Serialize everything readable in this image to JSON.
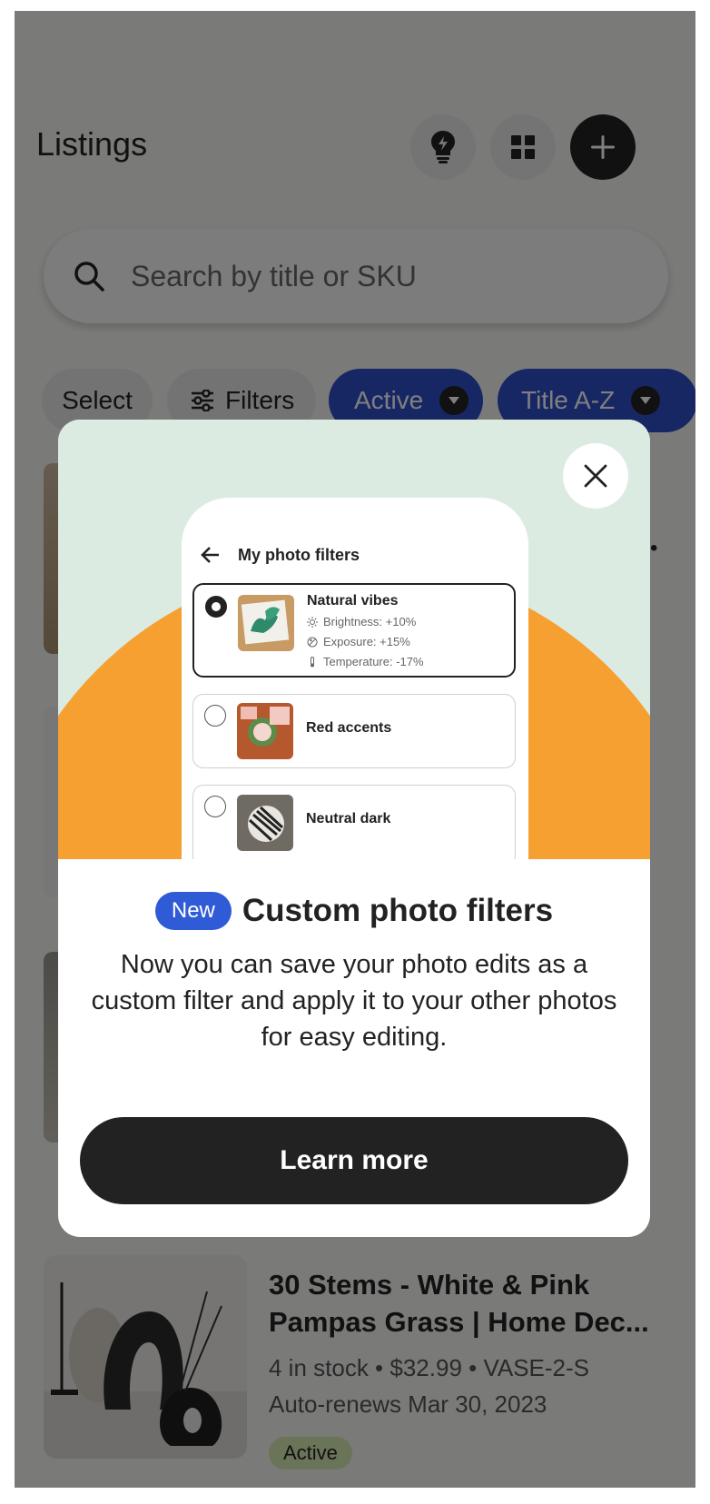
{
  "header": {
    "title": "Listings",
    "buttons": [
      "lightbulb-icon",
      "grid-icon",
      "plus-icon"
    ]
  },
  "search": {
    "placeholder": "Search by title or SKU"
  },
  "chips": [
    {
      "label": "Select"
    },
    {
      "label": "Filters"
    },
    {
      "label": "Active"
    },
    {
      "label": "Title A-Z"
    }
  ],
  "listing": {
    "title": "30 Stems - White & Pink Pampas Grass | Home Dec...",
    "meta1": "4 in stock • $32.99 • VASE-2-S",
    "meta2": "Auto-renews Mar 30, 2023",
    "status": "Active"
  },
  "modal": {
    "phone": {
      "header": "My photo filters",
      "filters": [
        {
          "name": "Natural vibes",
          "selected": true,
          "stats": [
            "Brightness: +10%",
            "Exposure: +15%",
            "Temperature: -17%"
          ]
        },
        {
          "name": "Red accents",
          "selected": false
        },
        {
          "name": "Neutral dark",
          "selected": false
        }
      ]
    },
    "badge": "New",
    "title": "Custom photo filters",
    "body": "Now you can save your photo edits as a custom filter and apply it to your other photos for easy editing.",
    "cta": "Learn more"
  },
  "colors": {
    "accent_blue": "#2f4ec8",
    "hero_bg": "#dcebe1",
    "sun_orange": "#f5a030",
    "badge_green": "#d4e9b0"
  }
}
